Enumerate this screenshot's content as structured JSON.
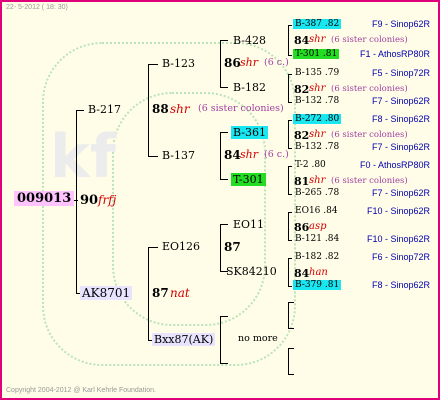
{
  "header": {
    "date": "22-  5-2012 ( 18: 30)"
  },
  "footer": {
    "copyright": "Copyright 2004-2012 @ Karl Kehrle Foundation."
  },
  "colors": {
    "border": "#e0007a",
    "background": "#fffde8",
    "highlight_cyan": "#18e6f0",
    "highlight_green": "#22dd22",
    "root_highlight": "#ffc4ff"
  },
  "root": {
    "id": "009013",
    "year": "90",
    "breeder": "frfj"
  },
  "gen2": [
    {
      "id": "B-217",
      "year": "88",
      "breeder": "shr",
      "sisters": "(6 sister colonies)"
    },
    {
      "id": "AK8701",
      "year": "87",
      "breeder": "nat"
    }
  ],
  "gen3": [
    {
      "id": "B-123",
      "year": "86",
      "breeder": "shr",
      "sisters": "(6 c.)"
    },
    {
      "id": "B-137",
      "year": "84",
      "breeder": "shr",
      "sisters": "(6 c.)"
    },
    {
      "id": "EO126",
      "year": "87"
    },
    {
      "id": "Bxx87(AK)",
      "note": "no more"
    }
  ],
  "gen4": [
    {
      "id": "B-428"
    },
    {
      "id": "B-182"
    },
    {
      "id": "B-361"
    },
    {
      "id": "T-301"
    },
    {
      "id": "EO11"
    },
    {
      "id": "SK84210"
    }
  ],
  "gen5": [
    {
      "type": "node",
      "id": "B-387",
      "year": ".82",
      "hl": "cyan",
      "line": "F9 - Sinop62R"
    },
    {
      "type": "summary",
      "year": "84",
      "breeder": "shr",
      "sisters": "(6 sister colonies)"
    },
    {
      "type": "node",
      "id": "T-301",
      "year": ".81",
      "hl": "green",
      "line": "F1 - AthosRP80R"
    },
    {
      "type": "node",
      "id": "B-135",
      "year": ".79",
      "hl": "",
      "line": "F5 - Sinop72R"
    },
    {
      "type": "summary",
      "year": "82",
      "breeder": "shr",
      "sisters": "(6 sister colonies)"
    },
    {
      "type": "node",
      "id": "B-132",
      "year": ".78",
      "hl": "",
      "line": "F7 - Sinop62R"
    },
    {
      "type": "node",
      "id": "B-272",
      "year": ".80",
      "hl": "cyan",
      "line": "F8 - Sinop62R"
    },
    {
      "type": "summary",
      "year": "82",
      "breeder": "shr",
      "sisters": "(6 sister colonies)"
    },
    {
      "type": "node",
      "id": "B-132",
      "year": ".78",
      "hl": "",
      "line": "F7 - Sinop62R"
    },
    {
      "type": "node",
      "id": "T-2",
      "year": ".80",
      "hl": "",
      "line": "F0 - AthosRP80R"
    },
    {
      "type": "summary",
      "year": "81",
      "breeder": "shr",
      "sisters": "(6 sister colonies)"
    },
    {
      "type": "node",
      "id": "B-265",
      "year": ".78",
      "hl": "",
      "line": "F7 - Sinop62R"
    },
    {
      "type": "node",
      "id": "EO16",
      "year": ".84",
      "hl": "",
      "line": "F10 - Sinop62R"
    },
    {
      "type": "summary",
      "year": "86",
      "breeder": "asp",
      "sisters": ""
    },
    {
      "type": "node",
      "id": "B-121",
      "year": ".84",
      "hl": "",
      "line": "F10 - Sinop62R"
    },
    {
      "type": "node",
      "id": "B-182",
      "year": ".82",
      "hl": "",
      "line": "F6 - Sinop72R"
    },
    {
      "type": "summary",
      "year": "84",
      "breeder": "han",
      "sisters": ""
    },
    {
      "type": "node",
      "id": "B-379",
      "year": ".81",
      "hl": "cyan",
      "line": "F8 - Sinop62R"
    }
  ]
}
